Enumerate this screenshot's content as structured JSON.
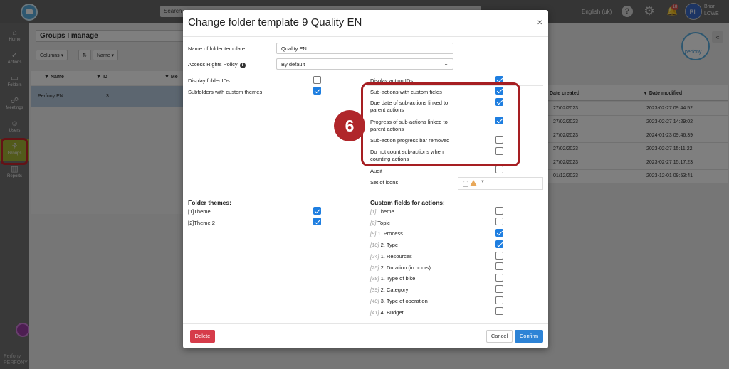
{
  "topbar": {
    "search_placeholder": "Search",
    "language": "English (uk)",
    "notifications_count": "18",
    "avatar_initials": "BL",
    "user_first": "Brian",
    "user_last": "LOWE"
  },
  "sidebar": {
    "items": [
      {
        "label": "Home",
        "icon": "home-icon"
      },
      {
        "label": "Actions",
        "icon": "check-circle-icon"
      },
      {
        "label": "Folders",
        "icon": "folder-icon"
      },
      {
        "label": "Meetings",
        "icon": "meetings-icon"
      },
      {
        "label": "Users",
        "icon": "users-icon"
      },
      {
        "label": "Groups",
        "icon": "groups-icon"
      },
      {
        "label": "Reports",
        "icon": "reports-icon"
      }
    ],
    "brand_line1": "Perfony",
    "brand_line2": "PERFONY"
  },
  "page": {
    "title": "Groups I manage",
    "columns_btn": "Columns",
    "name_btn": "Name",
    "table_headers": [
      "Name",
      "ID",
      "Me"
    ],
    "row": {
      "name": "Perfony EN",
      "id": "3"
    },
    "right_headers": [
      "Date created",
      "Date modified"
    ],
    "right_rows": [
      [
        "27/02/2023",
        "2023-02-27 09:44:52"
      ],
      [
        "27/02/2023",
        "2023-02-27 14:29:02"
      ],
      [
        "27/02/2023",
        "2024-01-23 09:46:39"
      ],
      [
        "27/02/2023",
        "2023-02-27 15:11:22"
      ],
      [
        "27/02/2023",
        "2023-02-27 15:17:23"
      ],
      [
        "01/12/2023",
        "2023-12-01 09:53:41"
      ]
    ],
    "perfony_logo_text": "perfony"
  },
  "modal": {
    "title": "Change folder template 9 Quality EN",
    "name_label": "Name of folder template",
    "name_value": "Quality EN",
    "policy_label": "Access Rights Policy",
    "policy_value": "By default",
    "left_options": [
      {
        "label": "Display folder IDs",
        "checked": false
      },
      {
        "label": "Subfolders with custom themes",
        "checked": true
      }
    ],
    "right_options": [
      {
        "label": "Display action IDs",
        "checked": true
      },
      {
        "label": "Sub-actions with custom fields",
        "checked": true
      },
      {
        "label": "Due date of sub-actions linked to parent actions",
        "checked": true
      },
      {
        "label": "Progress of sub-actions linked to parent actions",
        "checked": true
      },
      {
        "label": "Sub-action progress bar removed",
        "checked": false
      },
      {
        "label": "Do not count sub-actions when counting actions",
        "checked": false
      },
      {
        "label": "Audit",
        "checked": false
      }
    ],
    "icons_label": "Set of icons",
    "step_number": "6",
    "folder_themes_title": "Folder themes:",
    "folder_themes": [
      {
        "num": "[1]",
        "label": "Theme",
        "checked": true
      },
      {
        "num": "[2]",
        "label": "Theme 2",
        "checked": true
      }
    ],
    "custom_fields_title": "Custom fields for actions:",
    "custom_fields": [
      {
        "num": "[1]",
        "label": "Theme",
        "checked": false
      },
      {
        "num": "[2]",
        "label": "Topic",
        "checked": false
      },
      {
        "num": "[9]",
        "label": "1. Process",
        "checked": true
      },
      {
        "num": "[10]",
        "label": "2. Type",
        "checked": true
      },
      {
        "num": "[24]",
        "label": "1. Resources",
        "checked": false
      },
      {
        "num": "[25]",
        "label": "2. Duration (in hours)",
        "checked": false
      },
      {
        "num": "[38]",
        "label": "1. Type of bike",
        "checked": false
      },
      {
        "num": "[39]",
        "label": "2. Category",
        "checked": false
      },
      {
        "num": "[40]",
        "label": "3. Type of operation",
        "checked": false
      },
      {
        "num": "[41]",
        "label": "4. Budget",
        "checked": false
      }
    ],
    "delete_label": "Delete",
    "cancel_label": "Cancel",
    "confirm_label": "Confirm"
  },
  "colors": {
    "accent_blue": "#1e7ee0",
    "delete_red": "#d63c4a",
    "highlight_red": "#a61e22",
    "groups_green": "#a5b535"
  }
}
